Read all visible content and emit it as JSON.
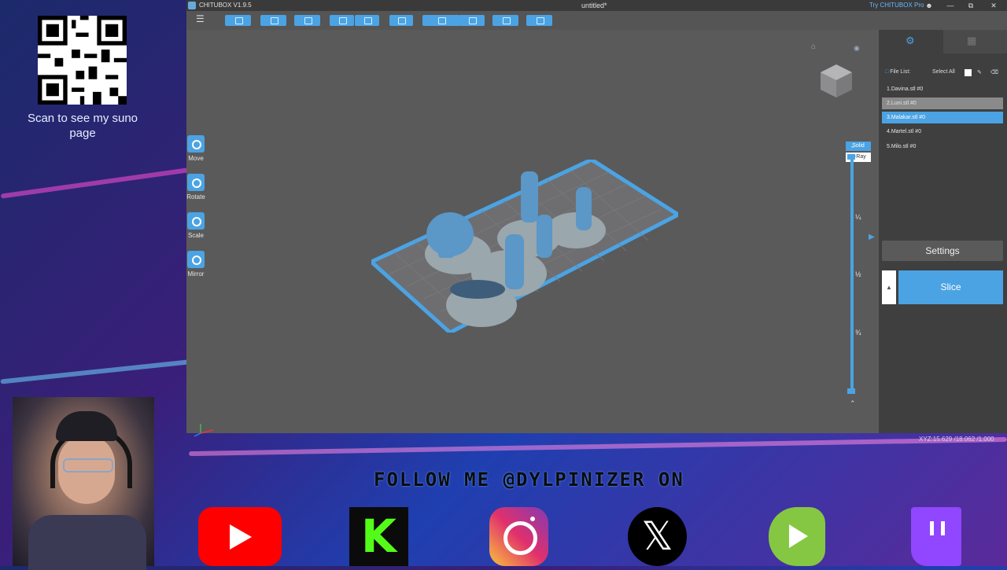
{
  "overlay": {
    "qr_caption": "Scan to see my suno page",
    "follow_text": "FOLLOW ME @DYLPINIZER ON",
    "socials": [
      "youtube-icon",
      "kick-icon",
      "instagram-icon",
      "x-icon",
      "rumble-icon",
      "twitch-icon"
    ]
  },
  "window": {
    "app_name": "CHITUBOX V1.9.5",
    "document_title": "untitled*",
    "try_pro": "Try CHITUBOX Pro",
    "controls": [
      "user-icon",
      "minimize-icon",
      "maximize-icon",
      "close-icon"
    ]
  },
  "toolbar": {
    "buttons": [
      "open-file-icon",
      "save-icon",
      "import-icon",
      "undo-icon",
      "redo-icon",
      "layout-icon",
      "support-icon",
      "hollow-icon",
      "drill-icon",
      "cut-icon"
    ]
  },
  "tools": [
    {
      "label": "Move",
      "icon": "move-icon"
    },
    {
      "label": "Rotate",
      "icon": "rotate-icon"
    },
    {
      "label": "Scale",
      "icon": "scale-icon"
    },
    {
      "label": "Mirror",
      "icon": "mirror-icon"
    }
  ],
  "view": {
    "solid_label": "Solid",
    "xray_label": "X-Ray",
    "slider_marks": [
      "¼",
      "½",
      "¾"
    ]
  },
  "files": {
    "header": "File List:",
    "select_all": "Select All",
    "items": [
      "1.Davina.stl #0",
      "2.Luni.stl #0",
      "3.Malakar.stl #0",
      "4.Martel.stl #0",
      "5.Milo.stl #0"
    ]
  },
  "actions": {
    "settings": "Settings",
    "slice": "Slice"
  },
  "status": {
    "xyz": "XYZ:15.629 /18.062 /1.000"
  },
  "colors": {
    "accent": "#4ba3e3",
    "viewport": "#5a5a5b",
    "panel": "#3f3f40"
  }
}
